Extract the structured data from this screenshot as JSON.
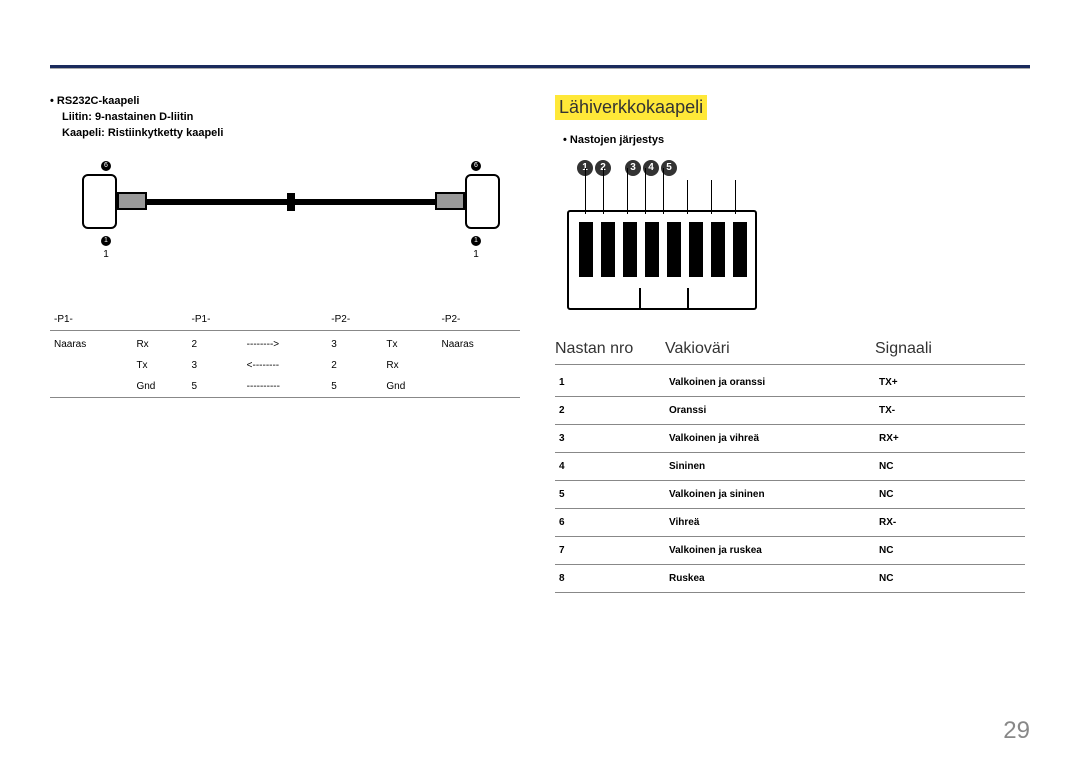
{
  "page": {
    "number": "29"
  },
  "left": {
    "bullet": "RS232C-kaapeli",
    "sub1": "Liitin: 9-nastainen D-liitin",
    "sub2": "Kaapeli: Ristiinkytketty kaapeli",
    "diagram": {
      "top_num": "6",
      "btm_num": "1",
      "btm_txt": "1"
    },
    "table": {
      "h1": "-P1-",
      "h2": "-P1-",
      "h3": "-P2-",
      "h4": "-P2-",
      "rows": [
        {
          "a": "Naaras",
          "b": "Rx",
          "c": "2",
          "d": "-------->",
          "e": "3",
          "f": "Tx",
          "g": "Naaras"
        },
        {
          "a": "",
          "b": "Tx",
          "c": "3",
          "d": "<--------",
          "e": "2",
          "f": "Rx",
          "g": ""
        },
        {
          "a": "",
          "b": "Gnd",
          "c": "5",
          "d": "----------",
          "e": "5",
          "f": "Gnd",
          "g": ""
        }
      ]
    }
  },
  "right": {
    "title": "Lähiverkkokaapeli",
    "bullet": "Nastojen järjestys",
    "nums": [
      "1",
      "2",
      "3",
      "4",
      "5"
    ],
    "headers": {
      "c1": "Nastan nro",
      "c2": "Vakioväri",
      "c3": "Signaali"
    },
    "rows": [
      {
        "n": "1",
        "col": "Valkoinen ja oranssi",
        "sig": "TX+"
      },
      {
        "n": "2",
        "col": "Oranssi",
        "sig": "TX-"
      },
      {
        "n": "3",
        "col": "Valkoinen ja vihreä",
        "sig": "RX+"
      },
      {
        "n": "4",
        "col": "Sininen",
        "sig": "NC"
      },
      {
        "n": "5",
        "col": "Valkoinen ja sininen",
        "sig": "NC"
      },
      {
        "n": "6",
        "col": "Vihreä",
        "sig": "RX-"
      },
      {
        "n": "7",
        "col": "Valkoinen ja ruskea",
        "sig": "NC"
      },
      {
        "n": "8",
        "col": "Ruskea",
        "sig": "NC"
      }
    ]
  }
}
